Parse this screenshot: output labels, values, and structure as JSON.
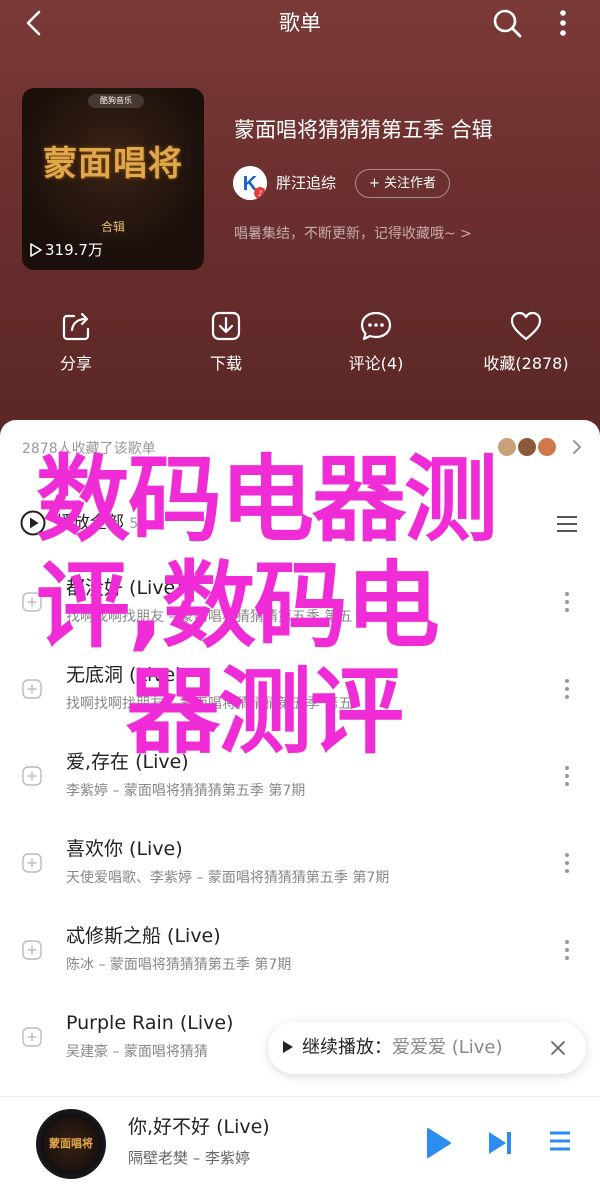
{
  "header": {
    "title": "歌单"
  },
  "album": {
    "cover_brand": "酷狗音乐",
    "cover_logo": "蒙面唱将",
    "cover_sub": "合辑",
    "plays": "319.7万",
    "title": "蒙面唱将猜猜猜第五季 合辑",
    "creator": "胖汪追综",
    "follow_label": "+ 关注作者",
    "desc": "唱暑集结，不断更新，记得收藏哦~ >"
  },
  "actions": {
    "share": "分享",
    "download": "下载",
    "comment": "评论(4)",
    "favorite": "收藏(2878)"
  },
  "collect": {
    "text": "2878人收藏了该歌单"
  },
  "playall": {
    "label": "播放全部",
    "count": "54"
  },
  "songs": [
    {
      "name": "都没好 (Live)",
      "meta": "找啊找啊找朋友 – 蒙面唱将猜猜猜第五季 第五"
    },
    {
      "name": "无底洞 (Live)",
      "meta": "找啊找啊找朋友 – 蒙面唱将猜猜猜第五季 第五"
    },
    {
      "name": "爱,存在 (Live)",
      "meta": "李紫婷 – 蒙面唱将猜猜猜第五季 第7期"
    },
    {
      "name": "喜欢你 (Live)",
      "meta": "天使爱唱歌、李紫婷 – 蒙面唱将猜猜猜第五季 第7期"
    },
    {
      "name": "忒修斯之船 (Live)",
      "meta": "陈冰 – 蒙面唱将猜猜猜第五季 第7期"
    },
    {
      "name": "Purple Rain (Live)",
      "meta": "吴建豪 – 蒙面唱将猜猜"
    }
  ],
  "continue_play": {
    "label": "继续播放：",
    "song": "爱爱爱 (Live)"
  },
  "player": {
    "disc_text": "蒙面唱将",
    "title": "你,好不好 (Live)",
    "artist": "隔壁老樊 – 李紫婷"
  },
  "watermark": {
    "line1": "数码电器测",
    "line2": "评,数码电",
    "line3": "器测评"
  }
}
